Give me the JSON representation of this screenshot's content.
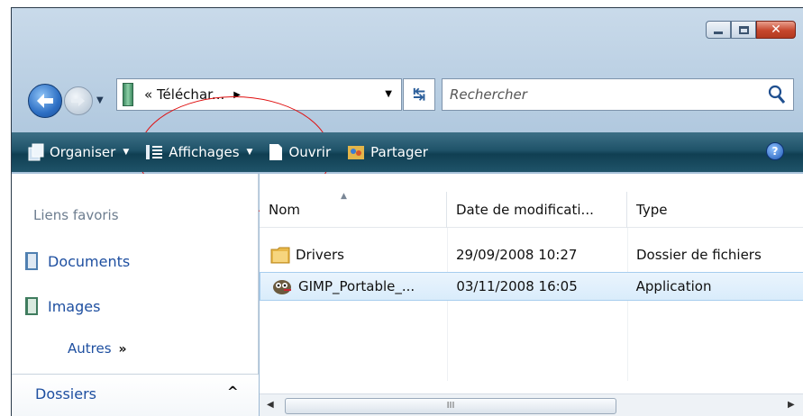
{
  "address": {
    "path": "« Téléchar...",
    "breadcrumb_arrow": "▶"
  },
  "search": {
    "placeholder": "Rechercher"
  },
  "toolbar": {
    "organiser": "Organiser",
    "affichages": "Affichages",
    "ouvrir": "Ouvrir",
    "partager": "Partager",
    "help": "?"
  },
  "nav_pane": {
    "favorites_title": "Liens favoris",
    "items": [
      {
        "label": "Documents",
        "icon": "documents-icon"
      },
      {
        "label": "Images",
        "icon": "images-icon"
      }
    ],
    "more": "Autres",
    "more_glyph": "»",
    "folders": "Dossiers"
  },
  "columns": {
    "nom": "Nom",
    "date": "Date de modificati...",
    "type": "Type"
  },
  "files": [
    {
      "name": "Drivers",
      "date": "29/09/2008 10:27",
      "type": "Dossier de fichiers",
      "icon": "folder-icon"
    },
    {
      "name": "GIMP_Portable_...",
      "date": "03/11/2008 16:05",
      "type": "Application",
      "icon": "gimp-icon",
      "selected": true
    }
  ],
  "scrollbar": {
    "grip": "III"
  },
  "colors": {
    "toolbar": "#1f5369",
    "link": "#1e4fa0",
    "annotation": "#e01010"
  }
}
